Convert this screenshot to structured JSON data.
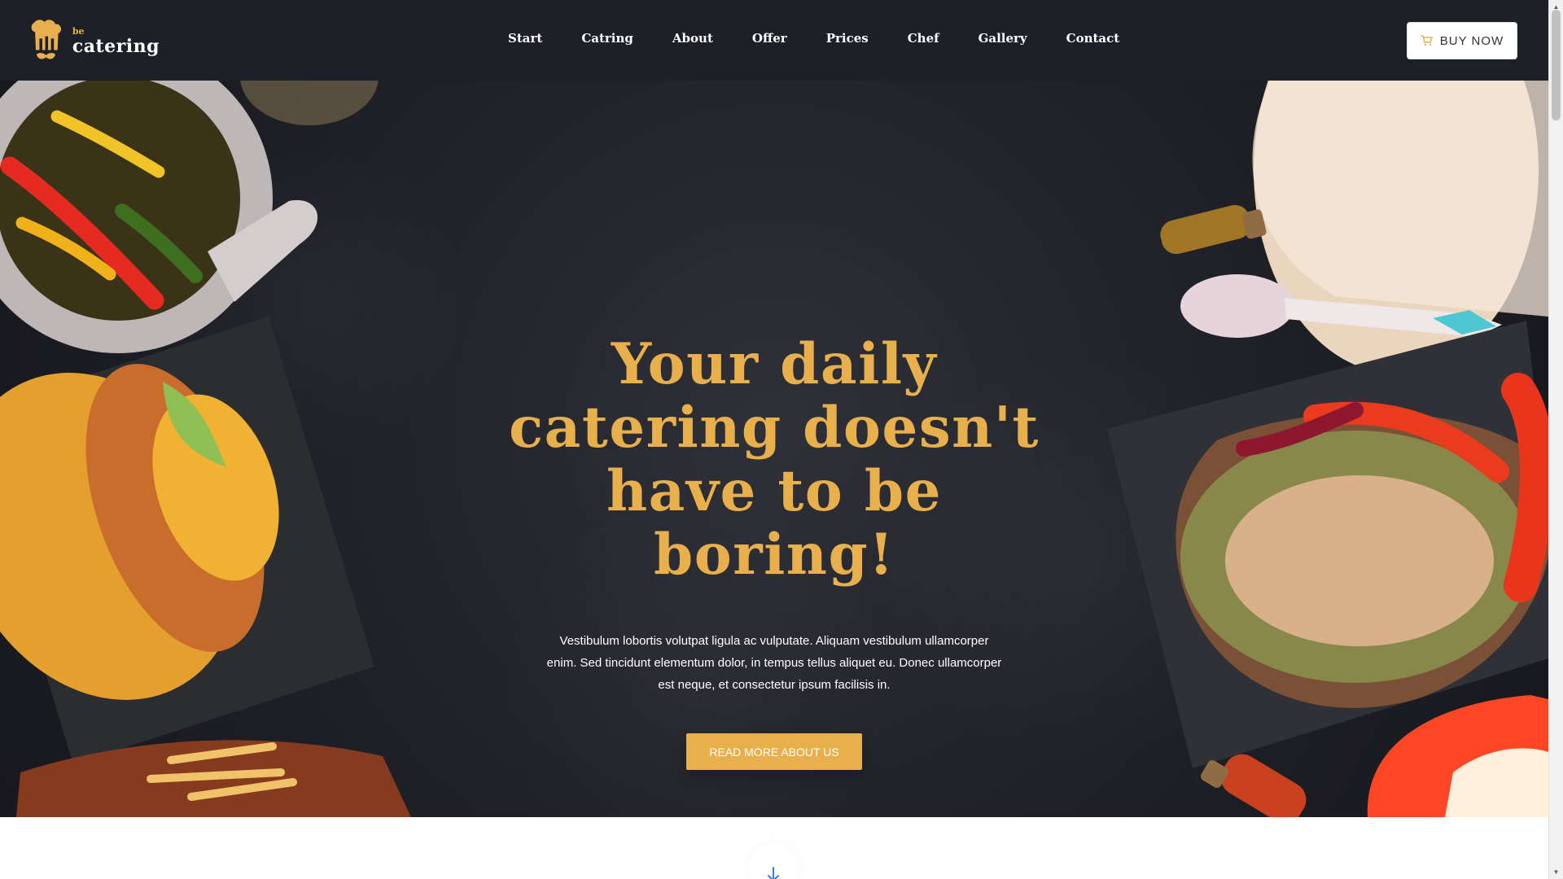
{
  "brand": {
    "small_text": "be",
    "main_text": "catering",
    "logo_icon": "chef-hat-mustache-icon"
  },
  "navigation": {
    "items": [
      {
        "label": "Start"
      },
      {
        "label": "Catring"
      },
      {
        "label": "About"
      },
      {
        "label": "Offer"
      },
      {
        "label": "Prices"
      },
      {
        "label": "Chef"
      },
      {
        "label": "Gallery"
      },
      {
        "label": "Contact"
      }
    ]
  },
  "header": {
    "buy_button_label": "BUY NOW",
    "cart_icon": "cart-icon"
  },
  "hero": {
    "title": "Your daily catering doesn't have to be boring!",
    "description": "Vestibulum lobortis volutpat ligula ac vulputate. Aliquam vestibulum ullamcorper enim. Sed tincidunt elementum dolor, in tempus tellus aliquet eu. Donec ullamcorper est neque, et consectetur ipsum facilisis in.",
    "cta_label": "READ MORE ABOUT US"
  },
  "scroll": {
    "icon": "down-arrow-icon"
  },
  "colors": {
    "accent": "#e7b04d",
    "navbar_background": "#1e2028",
    "hero_background": "#25262d",
    "cta_background": "#e7b04d",
    "scroll_arrow": "#1a73e8"
  }
}
